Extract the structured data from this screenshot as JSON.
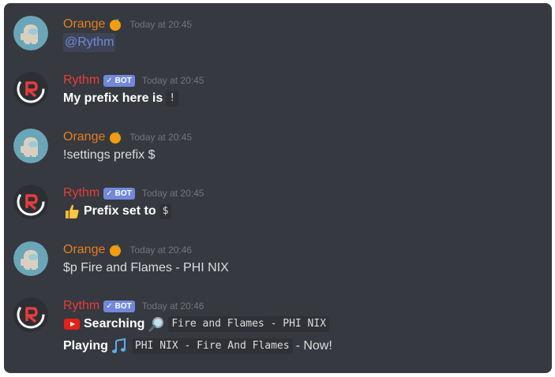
{
  "colors": {
    "background": "#36393f",
    "orange_name": "#e67e22",
    "rythm_name": "#e73c3c",
    "bot_tag": "#7289da",
    "timestamp": "#72767d",
    "text": "#dcddde",
    "mention": "#7289da"
  },
  "icons": {
    "orange_avatar": "among-us-crewmate-avatar",
    "rythm_avatar": "rythm-logo-avatar",
    "fruit": "tangerine-emoji",
    "bot_check": "check-icon",
    "thumbs_up": "thumbs-up-emoji",
    "youtube": "youtube-icon",
    "search": "magnifying-glass-emoji",
    "notes": "musical-notes-emoji"
  },
  "messages": [
    {
      "author": "Orange",
      "timestamp": "Today at 20:45",
      "mention": "@Rythm"
    },
    {
      "author": "Rythm",
      "bot_tag": "BOT",
      "timestamp": "Today at 20:45",
      "bold_text": "My prefix here is",
      "code": "!"
    },
    {
      "author": "Orange",
      "timestamp": "Today at 20:45",
      "text": "!settings prefix $"
    },
    {
      "author": "Rythm",
      "bot_tag": "BOT",
      "timestamp": "Today at 20:45",
      "bold_text": "Prefix set to",
      "code": "$"
    },
    {
      "author": "Orange",
      "timestamp": "Today at 20:46",
      "text": "$p Fire and Flames - PHI NIX"
    },
    {
      "author": "Rythm",
      "bot_tag": "BOT",
      "timestamp": "Today at 20:46",
      "searching_label": "Searching",
      "search_code": "Fire and Flames - PHI NIX",
      "playing_label": "Playing",
      "playing_code": "PHI NIX - Fire And Flames",
      "playing_suffix": "- Now!"
    }
  ]
}
